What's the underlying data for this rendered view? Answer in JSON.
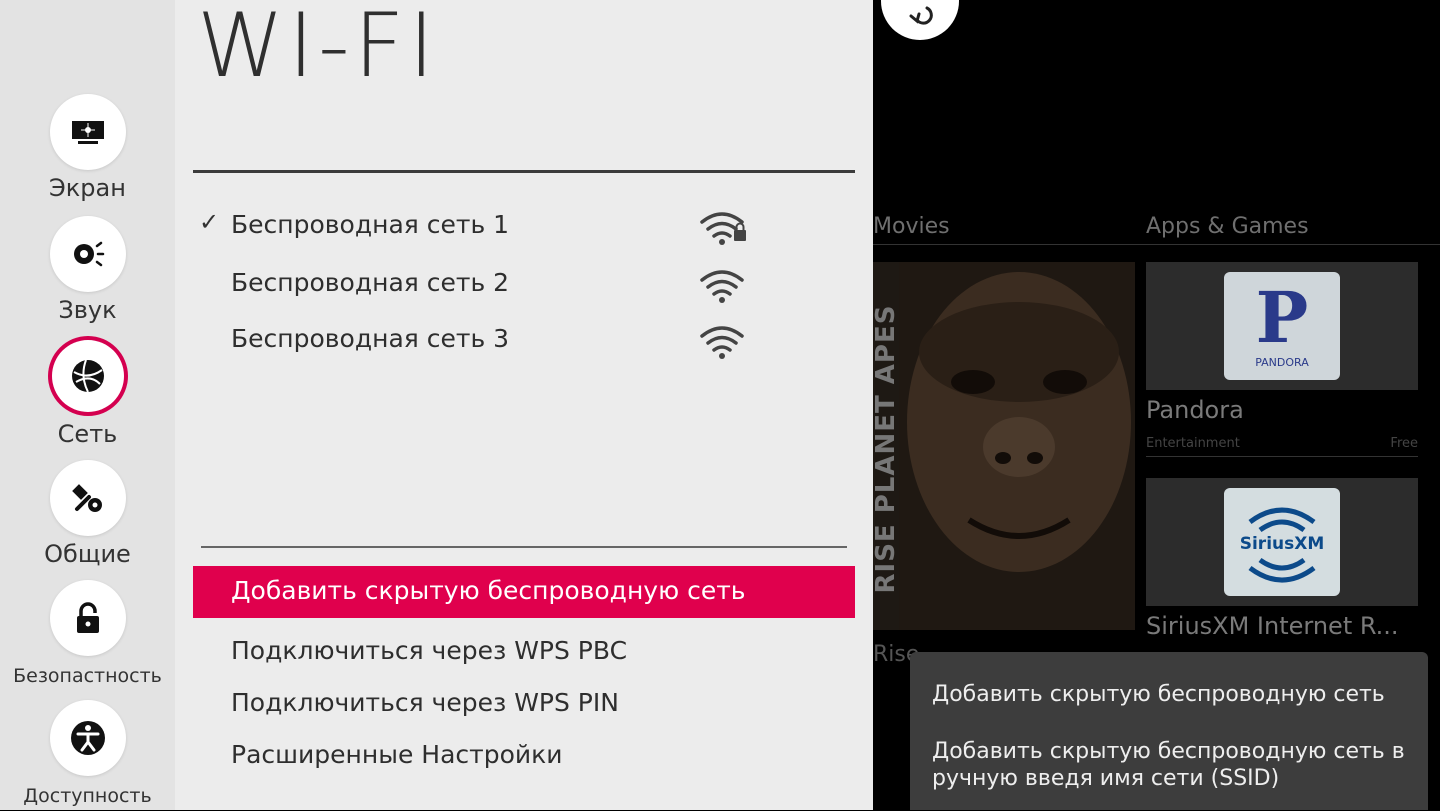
{
  "sidebar": {
    "items": [
      {
        "label": "Экран",
        "icon": "screen-icon"
      },
      {
        "label": "Звук",
        "icon": "sound-icon"
      },
      {
        "label": "Сеть",
        "icon": "network-globe-icon"
      },
      {
        "label": "Общие",
        "icon": "tools-icon"
      },
      {
        "label": "Безопастность",
        "icon": "lock-icon"
      },
      {
        "label": "Доступность",
        "icon": "accessibility-icon"
      }
    ],
    "active_index": 2
  },
  "panel": {
    "title": "WI-FI",
    "networks": [
      {
        "name": "Беспроводная сеть 1",
        "connected": true,
        "locked": true
      },
      {
        "name": "Беспроводная сеть 2",
        "connected": false,
        "locked": false
      },
      {
        "name": "Беспроводная сеть 3",
        "connected": false,
        "locked": false
      }
    ],
    "check_mark": "✓",
    "options": [
      {
        "label": "Добавить скрытую беспроводную сеть",
        "selected": true
      },
      {
        "label": "Подключиться через WPS PBC",
        "selected": false
      },
      {
        "label": "Подключиться через WPS PIN",
        "selected": false
      },
      {
        "label": "Расширенные Настройки",
        "selected": false
      }
    ]
  },
  "background": {
    "section_movies": "Movies",
    "section_apps": "Apps & Games",
    "poster_title": "RISE PLANET APES",
    "poster_caption": "Rise",
    "apps": [
      {
        "name": "Pandora",
        "category": "Entertainment",
        "price": "Free",
        "logo_text": "P",
        "logo_sub": "PANDORA"
      },
      {
        "name": "SiriusXM Internet R...",
        "logo_text": "SiriusXM"
      }
    ]
  },
  "tooltip": {
    "title": "Добавить скрытую беспроводную сеть",
    "description": "Добавить скрытую беспроводную сеть в ручную введя имя сети (SSID)"
  },
  "colors": {
    "accent": "#e0004d",
    "panel_bg": "#ececec",
    "sidebar_bg": "#e3e3e3",
    "tooltip_bg": "#3d3d3d"
  }
}
